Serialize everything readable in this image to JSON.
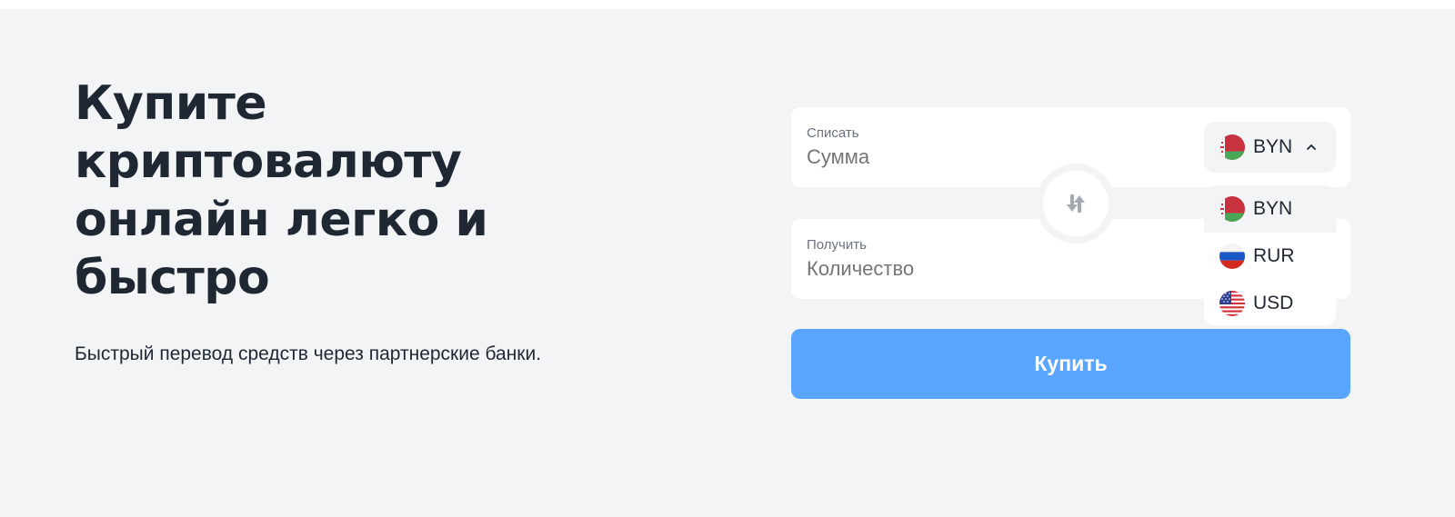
{
  "hero": {
    "title": "Купите криптовалюту онлайн легко и быстро",
    "subtitle": "Быстрый перевод средств через партнерские банки."
  },
  "form": {
    "from_label": "Списать",
    "from_placeholder": "Сумма",
    "to_label": "Получить",
    "to_placeholder": "Количество",
    "selected_currency": "BYN",
    "currency_options": [
      {
        "code": "BYN",
        "flag": "belarus-flag-icon"
      },
      {
        "code": "RUR",
        "flag": "russia-flag-icon"
      },
      {
        "code": "USD",
        "flag": "usa-flag-icon"
      }
    ],
    "swap_icon": "swap-arrows-icon",
    "buy_label": "Купить"
  },
  "colors": {
    "background": "#f3f4f6",
    "accent": "#5aa5ff",
    "text": "#1f2733",
    "muted": "#6b7280"
  }
}
